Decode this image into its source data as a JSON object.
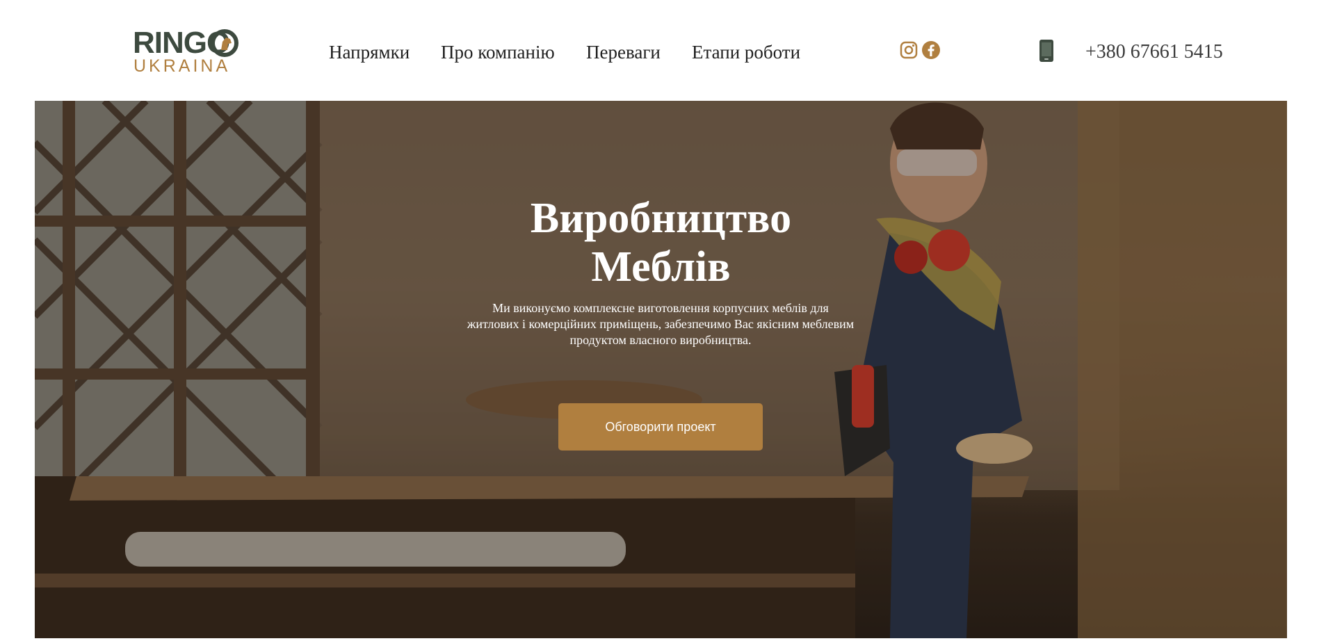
{
  "logo": {
    "top_text": "RINGO",
    "bottom_text": "UKRAINA"
  },
  "nav": {
    "items": [
      {
        "label": "Напрямки"
      },
      {
        "label": "Про компанію"
      },
      {
        "label": "Переваги"
      },
      {
        "label": "Етапи роботи"
      }
    ]
  },
  "social": {
    "icons": [
      "instagram-icon",
      "facebook-icon"
    ]
  },
  "contact": {
    "phone_icon": "phone-icon",
    "phone": "+380 67661 5415"
  },
  "hero": {
    "title_line1": "Виробництво",
    "title_line2": "Меблів",
    "description": "Ми виконуємо комплексне виготовлення корпусних меблів для житлових і комерційних приміщень, забезпечимо Вас якісним меблевим продуктом власного виробництва.",
    "button_label": "Обговорити проект"
  },
  "colors": {
    "accent": "#b07f3f",
    "logo_dark": "#3d4a3f",
    "icon_gold": "#b07f3f"
  }
}
